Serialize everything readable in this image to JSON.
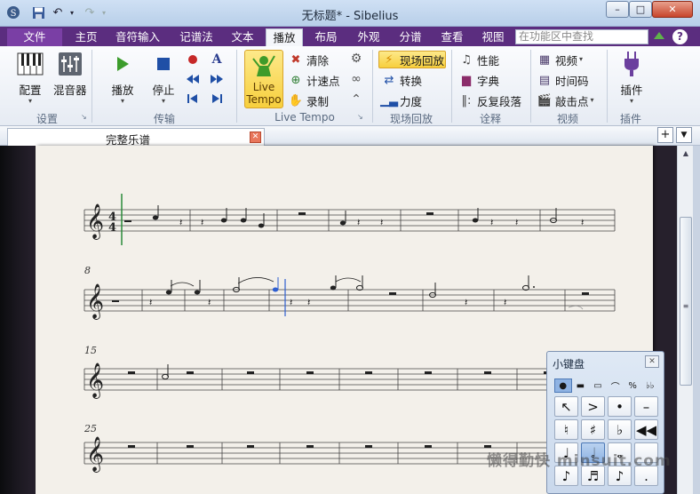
{
  "window": {
    "title": "无标题* - Sibelius",
    "controls": [
      "–",
      "□",
      "✕"
    ]
  },
  "tabs": {
    "items": [
      "文件",
      "主页",
      "音符输入",
      "记谱法",
      "文本",
      "播放",
      "布局",
      "外观",
      "分谱",
      "查看",
      "视图"
    ],
    "active": "播放",
    "search_placeholder": "在功能区中查找",
    "help": "?"
  },
  "ribbon": {
    "setup": {
      "label": "设置",
      "config": "配置",
      "mixer": "混音器"
    },
    "transport": {
      "label": "传输",
      "play": "播放",
      "stop": "停止"
    },
    "live_tempo": {
      "label": "Live Tempo",
      "button": "Live Tempo",
      "clear": "清除",
      "count_in": "计速点",
      "record": "录制"
    },
    "live_playback": {
      "label": "现场回放",
      "live_playback": "现场回放",
      "transform": "转换",
      "velocity": "力度"
    },
    "interpretation": {
      "label": "诠释",
      "performance": "性能",
      "dictionary": "字典",
      "repeats": "反复段落"
    },
    "video": {
      "label": "视频",
      "video": "视频",
      "timecode": "时间码",
      "hit_points": "敲击点"
    },
    "plugins": {
      "label": "插件",
      "plugins": "插件"
    }
  },
  "document": {
    "tab_label": "完整乐谱",
    "add": "+",
    "menu": "▼"
  },
  "score": {
    "time_signature": {
      "top": "4",
      "bottom": "4"
    },
    "bar_numbers": [
      "8",
      "15",
      "25"
    ]
  },
  "keypad": {
    "title": "小键盘",
    "close": "✕",
    "layout_tabs": [
      {
        "glyph": "●",
        "name": "common-notes-tab"
      },
      {
        "glyph": "▬",
        "name": "more-notes-tab"
      },
      {
        "glyph": "▭",
        "name": "beams-tremolos-tab"
      },
      {
        "glyph": "⌒",
        "name": "articulations-tab"
      },
      {
        "glyph": "%",
        "name": "jazz-articulations-tab"
      },
      {
        "glyph": "♭♭",
        "name": "accidentals-tab"
      }
    ],
    "keys": [
      {
        "glyph": "↖",
        "name": "select-key"
      },
      {
        "glyph": ">",
        "name": "accent-key"
      },
      {
        "glyph": "•",
        "name": "staccato-key"
      },
      {
        "glyph": "–",
        "name": "tenuto-key"
      },
      {
        "glyph": "♮",
        "name": "natural-key"
      },
      {
        "glyph": "♯",
        "name": "sharp-key"
      },
      {
        "glyph": "♭",
        "name": "flat-key"
      },
      {
        "glyph": "◀◀",
        "name": "rewind-key"
      },
      {
        "glyph": "♩",
        "name": "quarter-note-key"
      },
      {
        "glyph": "𝅗𝅥",
        "name": "half-note-key"
      },
      {
        "glyph": "𝅝",
        "name": "whole-note-key"
      },
      {
        "glyph": "",
        "name": "blank-key"
      },
      {
        "glyph": "♪",
        "name": "eighth-note-key"
      },
      {
        "glyph": "♬",
        "name": "sixteenth-note-key"
      },
      {
        "glyph": "♪",
        "name": "thirty-second-note-key"
      },
      {
        "glyph": ".",
        "name": "dot-key"
      }
    ]
  },
  "watermark": "懒得勤快 minsuit.com",
  "colors": {
    "tab_bar": "#5b2d7f",
    "live_tempo_highlight": "#f7cf3d",
    "selected_note": "#2f5fd0",
    "playback_line": "#2a8a3a"
  }
}
